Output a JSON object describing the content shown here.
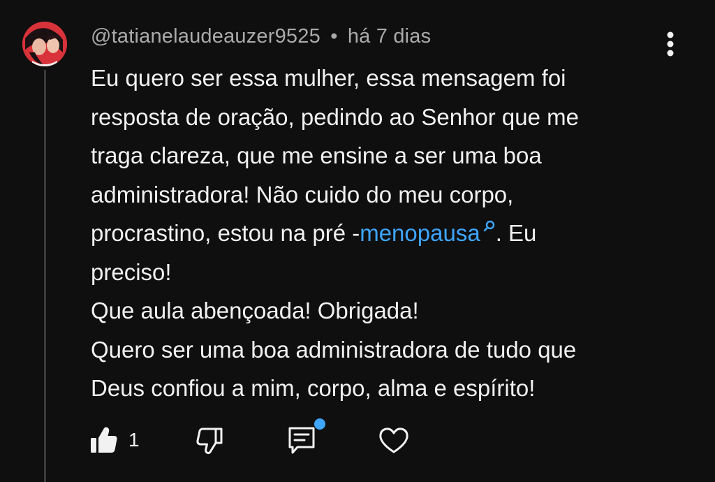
{
  "comment": {
    "author": "@tatianelaudeauzer9525",
    "separator": "•",
    "time_ago": "há 7 dias",
    "lines": {
      "l1": "Eu quero ser essa mulher, essa mensagem foi",
      "l2": "resposta de oração, pedindo ao Senhor que me",
      "l3": "traga clareza, que me ensine a ser uma boa",
      "l4": "administradora! Não cuido do meu corpo,",
      "l5_before": "procrastino, estou na pré -",
      "l5_link": "menopausa",
      "l5_after": ". Eu",
      "l6": "preciso!",
      "l7": "Que aula abençoada! Obrigada!",
      "l8": "Quero ser uma boa administradora de tudo que",
      "l9": "Deus confiou a mim, corpo, alma e espírito!"
    }
  },
  "actions": {
    "like_count": "1"
  },
  "icons": {
    "menu": "more-vertical-icon",
    "like": "thumbs-up-filled-icon",
    "dislike": "thumbs-down-outline-icon",
    "reply": "comment-icon",
    "heart": "heart-outline-icon",
    "search": "search-icon"
  },
  "colors": {
    "background": "#0f0f0f",
    "text": "#f1f1f1",
    "meta": "#aaaaaa",
    "link": "#3ea6ff",
    "thread_line": "#3a3a3a",
    "notification_dot": "#3ea6ff"
  }
}
